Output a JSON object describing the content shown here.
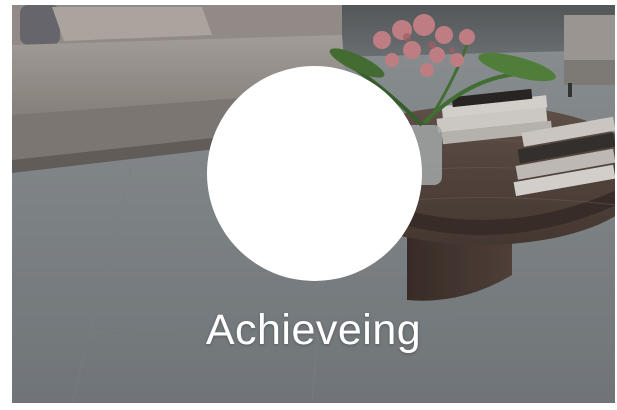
{
  "card": {
    "caption": "Achieveing",
    "background_scene": "living-room-photo",
    "circle_color": "#ffffff",
    "caption_color": "#ffffff"
  }
}
